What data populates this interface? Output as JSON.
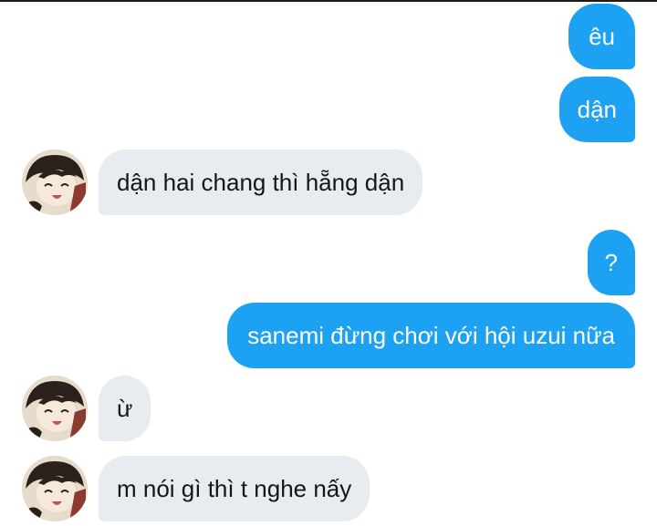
{
  "conversation": {
    "messages": [
      {
        "sender": "me",
        "text": "êu"
      },
      {
        "sender": "me",
        "text": "dận"
      },
      {
        "sender": "other",
        "text": "dận hai chang thì hẵng dận"
      },
      {
        "sender": "me",
        "text": "?"
      },
      {
        "sender": "me",
        "text": "sanemi đừng chơi với hội uzui nữa"
      },
      {
        "sender": "other",
        "text": "ừ"
      },
      {
        "sender": "other",
        "text": "m nói gì thì t nghe nấy"
      }
    ]
  },
  "colors": {
    "sent_bubble": "#1da1f2",
    "received_bubble": "#e6ecf0",
    "sent_text": "#ffffff",
    "received_text": "#14171a"
  },
  "icons": {
    "avatar": "anime-character-avatar"
  }
}
